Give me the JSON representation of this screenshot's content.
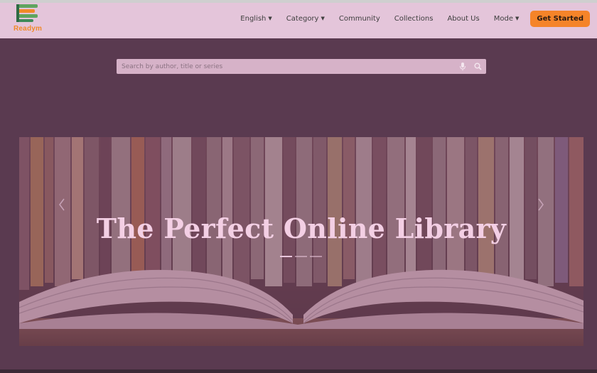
{
  "brand": {
    "name": "Readym"
  },
  "nav": {
    "items": [
      {
        "label": "English",
        "dropdown": true
      },
      {
        "label": "Category",
        "dropdown": true
      },
      {
        "label": "Community",
        "dropdown": false
      },
      {
        "label": "Collections",
        "dropdown": false
      },
      {
        "label": "About Us",
        "dropdown": false
      },
      {
        "label": "Mode",
        "dropdown": true
      }
    ],
    "cta_label": "Get Started"
  },
  "search": {
    "placeholder": "Search by author, title or series"
  },
  "hero": {
    "title": "The Perfect Online Library",
    "slide_count": 3,
    "active_slide": 1
  },
  "colors": {
    "accent": "#f58429",
    "navbar": "#e4c5da",
    "background": "#5a3a50"
  },
  "icons": [
    "logo-icon",
    "mic-icon",
    "search-icon",
    "caret-down-icon",
    "chevron-left-icon",
    "chevron-right-icon"
  ]
}
